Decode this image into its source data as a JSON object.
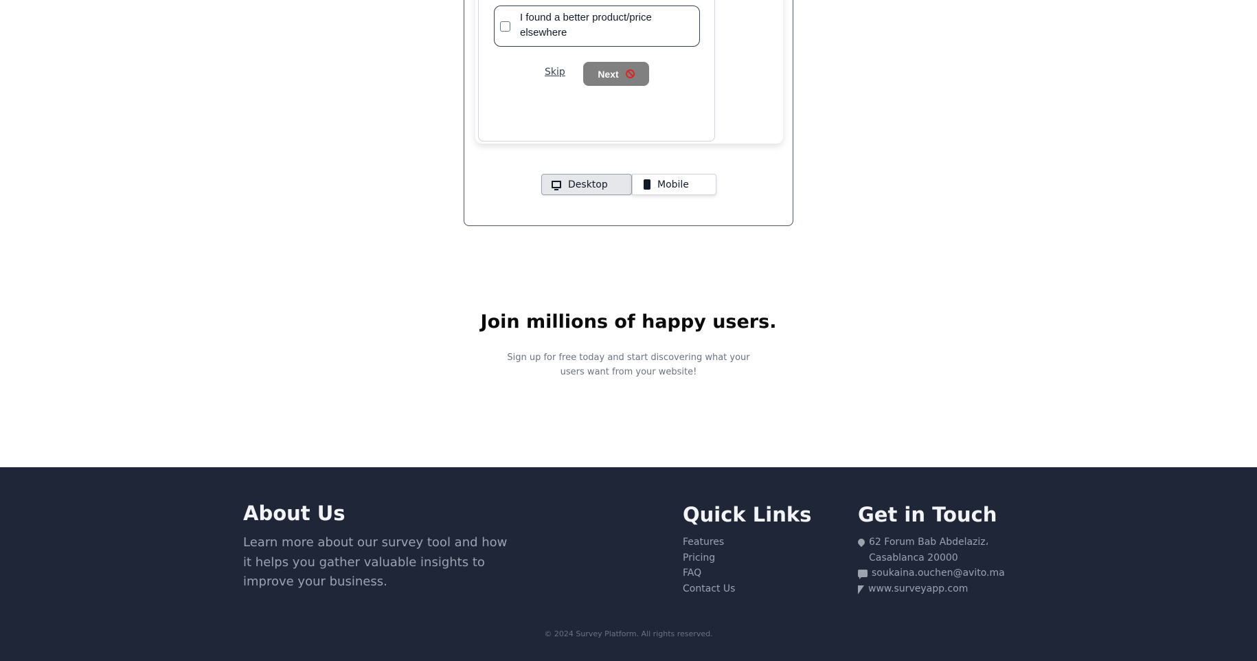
{
  "survey_preview": {
    "option_label": "I found a better product/price elsewhere",
    "skip_label": "Skip",
    "next_label": "Next",
    "view_toggle": {
      "desktop_label": "Desktop",
      "mobile_label": "Mobile",
      "selected": "Desktop"
    }
  },
  "cta": {
    "title": "Join millions of happy users.",
    "subtitle": "Sign up for free today and start discovering what your users want from your website!"
  },
  "footer": {
    "about": {
      "title": "About Us",
      "text": "Learn more about our survey tool and how it helps you gather valuable insights to improve your business."
    },
    "quick_links": {
      "title": "Quick Links",
      "items": [
        "Features",
        "Pricing",
        "FAQ",
        "Contact Us"
      ]
    },
    "contact": {
      "title": "Get in Touch",
      "address": "62 Forum Bab Abdelaziz، Casablanca 20000",
      "email": "soukaina.ouchen@avito.ma",
      "website": "www.surveyapp.com"
    },
    "copyright": "© 2024 Survey Platform. All rights reserved."
  },
  "colors": {
    "footer_bg": "#1f2638",
    "next_button_bg": "#808080",
    "ban_icon": "#dc2626"
  },
  "icons": [
    "ban-icon",
    "desktop-icon",
    "mobile-icon",
    "map-pin-icon",
    "chat-icon",
    "cursor-icon"
  ]
}
